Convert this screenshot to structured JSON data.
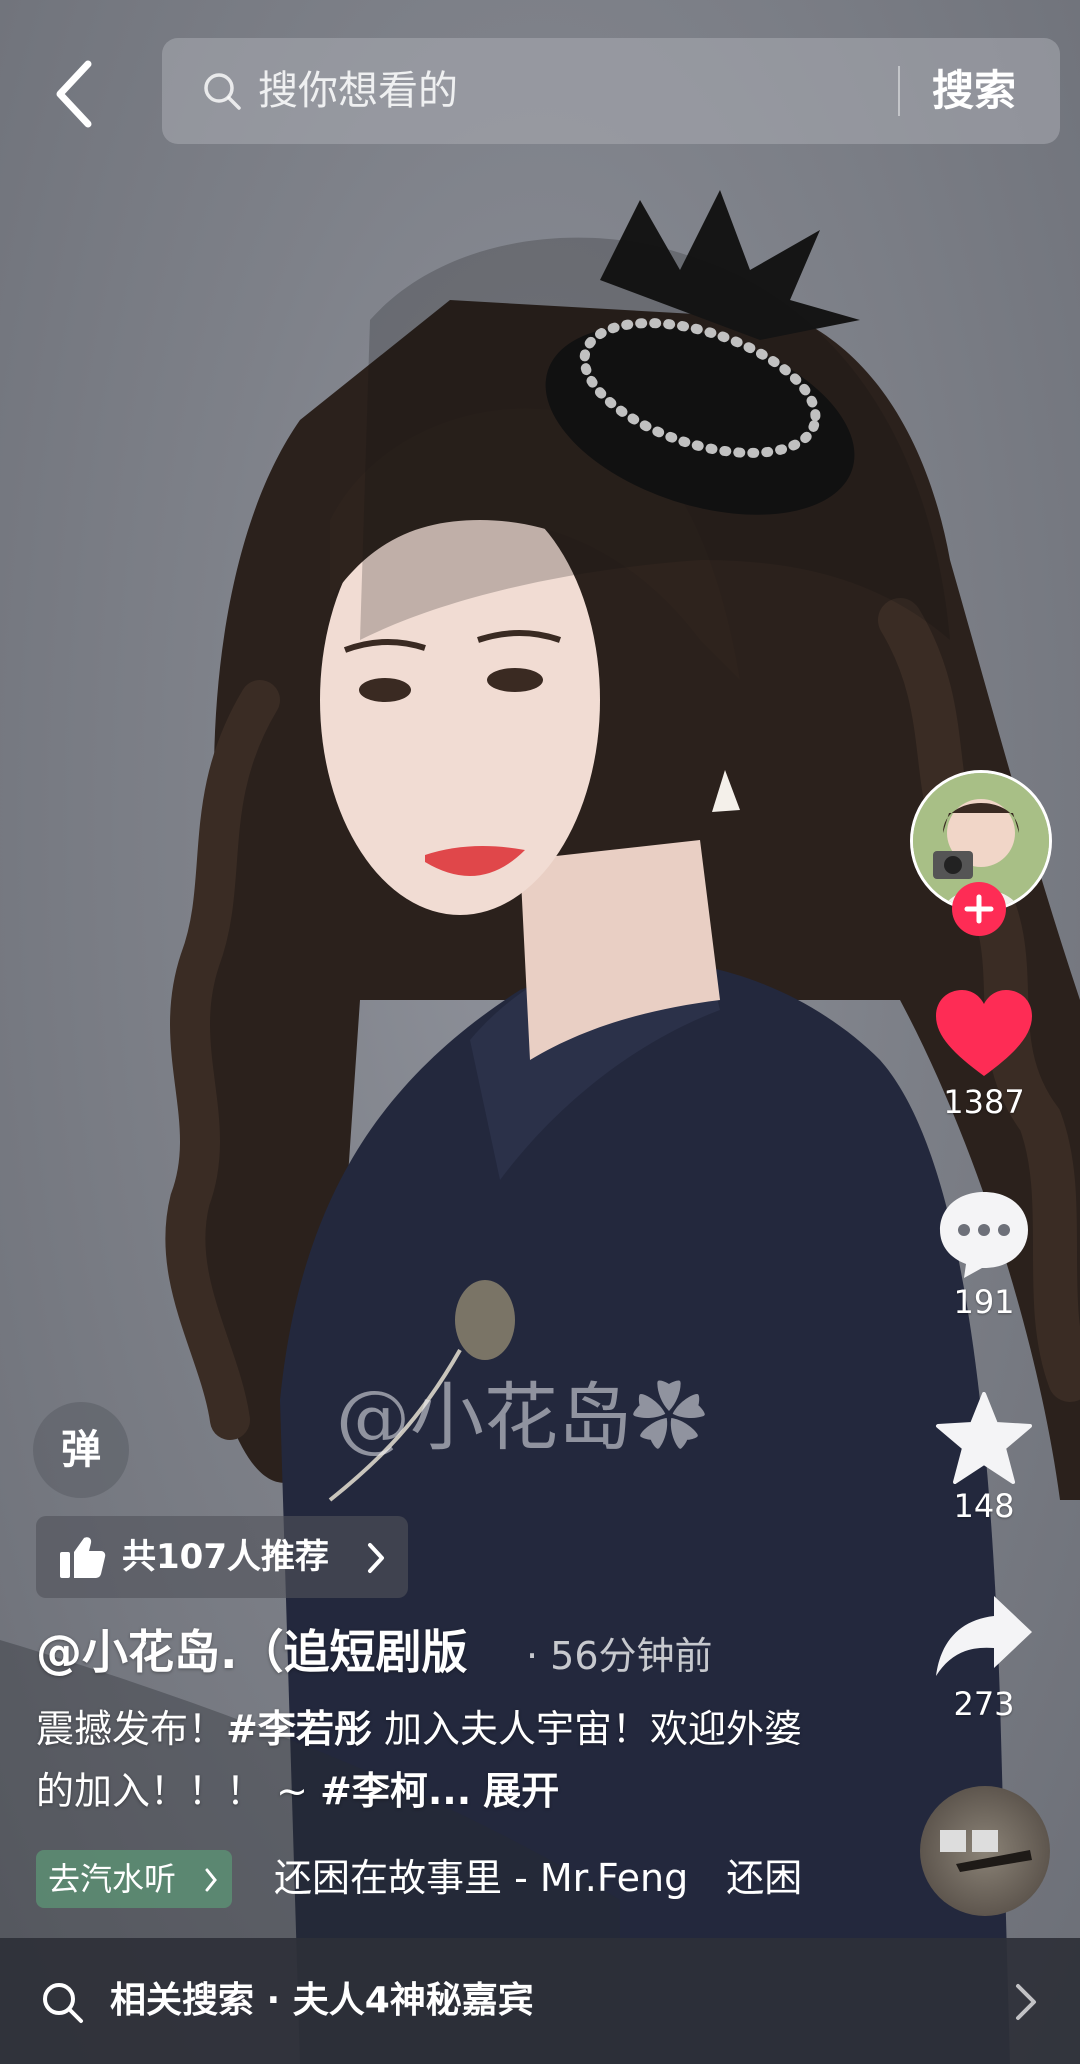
{
  "search": {
    "placeholder": "搜你想看的",
    "button_label": "搜索"
  },
  "watermark": "@小花岛✿",
  "rail": {
    "likes": "1387",
    "comments": "191",
    "favorites": "148",
    "shares": "273"
  },
  "danmu_label": "弹",
  "recommend_label": "共107人推荐",
  "author": "@小花岛.（追短剧版",
  "post_time": "· 56分钟前",
  "caption": {
    "text1": "震撼发布！",
    "tag1": "#李若彤",
    "text2": " 加入夫人宇宙！欢迎外婆的加入！！！ ~ ",
    "tag2": "#李柯...",
    "expand": "展开"
  },
  "music": {
    "qishui_label": "去汽水听",
    "song": "还困在故事里 - Mr.Feng　还困"
  },
  "related_search": "相关搜索 · 夫人4神秘嘉宾",
  "colors": {
    "accent": "#fe2c55",
    "qishui": "#5c9676"
  }
}
